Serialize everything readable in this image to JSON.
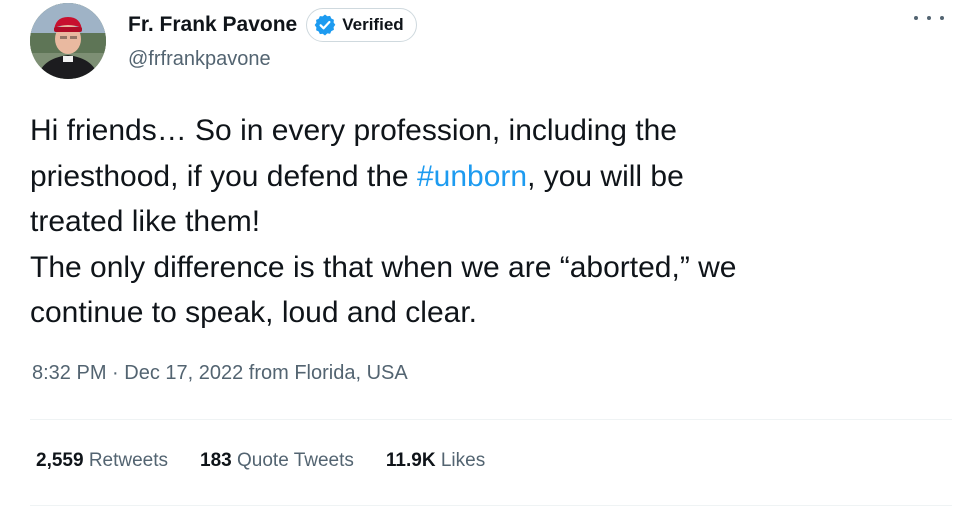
{
  "author": {
    "display_name": "Fr. Frank Pavone",
    "verified_label": "Verified",
    "handle": "@frfrankpavone"
  },
  "tweet": {
    "text_before": "Hi friends… So in every profession, including the\npriesthood, if you defend the ",
    "hashtag": "#unborn",
    "text_after": ", you will be\ntreated like them!\nThe only difference is that when we are “aborted,” we\ncontinue to speak, loud and clear.",
    "timestamp": "8:32 PM · Dec 17, 2022 from Florida, USA"
  },
  "stats": {
    "retweets_count": "2,559",
    "retweets_label": "Retweets",
    "quotes_count": "183",
    "quotes_label": "Quote Tweets",
    "likes_count": "11.9K",
    "likes_label": "Likes"
  },
  "colors": {
    "accent": "#1d9bf0",
    "text": "#0f1419",
    "muted": "#536471",
    "divider": "#eff3f4"
  },
  "icons": {
    "verified": "verified-badge-icon",
    "more": "more-options-icon"
  }
}
